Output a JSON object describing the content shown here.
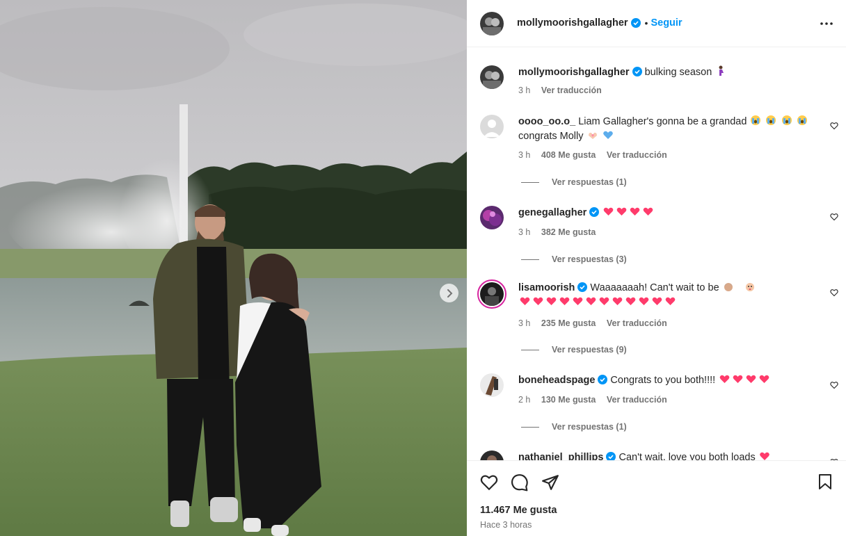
{
  "post": {
    "author": "mollymoorishgallagher",
    "follow_label": "Seguir",
    "caption_author": "mollymoorishgallagher",
    "caption": "bulking season",
    "caption_emoji": "pregnant-woman-emoji",
    "caption_time": "3 h",
    "caption_translate": "Ver traducción"
  },
  "comments": [
    {
      "user": "oooo_oo.o_",
      "text": "Liam Gallagher's gonna be a grandad",
      "text_line2": "congrats Molly",
      "time": "3 h",
      "likes": "408 Me gusta",
      "translate": "Ver traducción",
      "replies": "Ver respuestas (1)"
    },
    {
      "user": "genegallagher",
      "text": "",
      "time": "3 h",
      "likes": "382 Me gusta",
      "replies": "Ver respuestas (3)"
    },
    {
      "user": "lisamoorish",
      "text": "Waaaaaaah! Can't wait to be",
      "time": "3 h",
      "likes": "235 Me gusta",
      "translate": "Ver traducción",
      "replies": "Ver respuestas (9)"
    },
    {
      "user": "boneheadspage",
      "text": "Congrats to you both!!!!",
      "time": "2 h",
      "likes": "130 Me gusta",
      "translate": "Ver traducción",
      "replies": "Ver respuestas (1)"
    },
    {
      "user": "nathaniel_phillips",
      "text": "Can't wait, love you both loads"
    }
  ],
  "footer": {
    "likes": "11.467 Me gusta",
    "time": "Hace 3 horas"
  },
  "colors": {
    "accent": "#0095f6",
    "heart": "#ff3b6b",
    "text": "#262626",
    "muted": "#737373"
  }
}
